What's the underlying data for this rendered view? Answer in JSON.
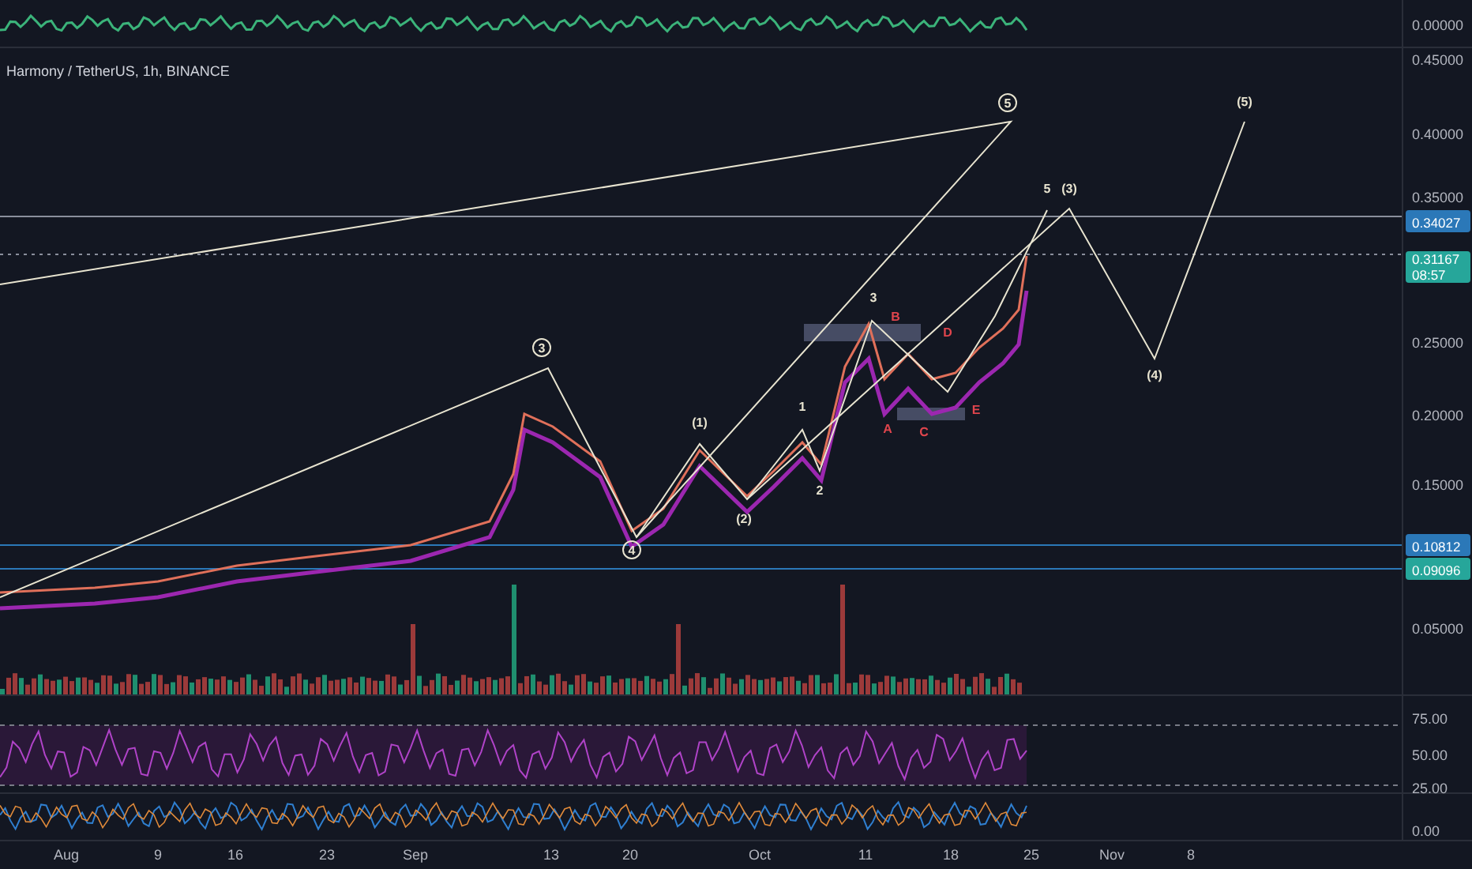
{
  "legend": {
    "title": "Harmony / TetherUS, 1h, BINANCE"
  },
  "top_pane": {
    "axis_labels": [
      "0.00000"
    ]
  },
  "price_axis": {
    "labels": [
      "0.45000",
      "0.40000",
      "0.35000",
      "0.25000",
      "0.20000",
      "0.15000",
      "0.05000"
    ]
  },
  "price_badges": [
    {
      "kind": "line",
      "value": "0.34027",
      "color": "#2b78b8"
    },
    {
      "kind": "last",
      "value": "0.31167",
      "countdown": "08:57",
      "color": "#26a69a"
    },
    {
      "kind": "line",
      "value": "0.10812",
      "color": "#2b78b8"
    },
    {
      "kind": "line",
      "value": "0.09096",
      "color": "#26a69a"
    }
  ],
  "wave_labels": [
    {
      "text": "3",
      "circled": true,
      "color": "#e8e4d0"
    },
    {
      "text": "4",
      "circled": true,
      "color": "#e8e4d0"
    },
    {
      "text": "5",
      "circled": true,
      "color": "#e8e4d0"
    },
    {
      "text": "(1)",
      "circled": false,
      "color": "#e8e4d0"
    },
    {
      "text": "(2)",
      "circled": false,
      "color": "#e8e4d0"
    },
    {
      "text": "1",
      "circled": false,
      "color": "#e8e4d0"
    },
    {
      "text": "2",
      "circled": false,
      "color": "#e8e4d0"
    },
    {
      "text": "3",
      "circled": false,
      "color": "#e8e4d0"
    },
    {
      "text": "B",
      "circled": false,
      "color": "#e0454d"
    },
    {
      "text": "D",
      "circled": false,
      "color": "#e0454d"
    },
    {
      "text": "A",
      "circled": false,
      "color": "#e0454d"
    },
    {
      "text": "C",
      "circled": false,
      "color": "#e0454d"
    },
    {
      "text": "E",
      "circled": false,
      "color": "#e0454d"
    },
    {
      "text": "5",
      "circled": false,
      "color": "#e8e4d0"
    },
    {
      "text": "(3)",
      "circled": false,
      "color": "#e8e4d0"
    },
    {
      "text": "(4)",
      "circled": false,
      "color": "#e8e4d0"
    },
    {
      "text": "(5)",
      "circled": false,
      "color": "#e8e4d0"
    }
  ],
  "rsi_pane": {
    "axis_labels": [
      "75.00",
      "50.00",
      "25.00"
    ]
  },
  "bottom_pane": {
    "axis_labels": [
      "0.00"
    ]
  },
  "time_axis": {
    "labels": [
      "Aug",
      "9",
      "16",
      "23",
      "Sep",
      "13",
      "20",
      "Oct",
      "11",
      "18",
      "25",
      "Nov",
      "8"
    ]
  }
}
